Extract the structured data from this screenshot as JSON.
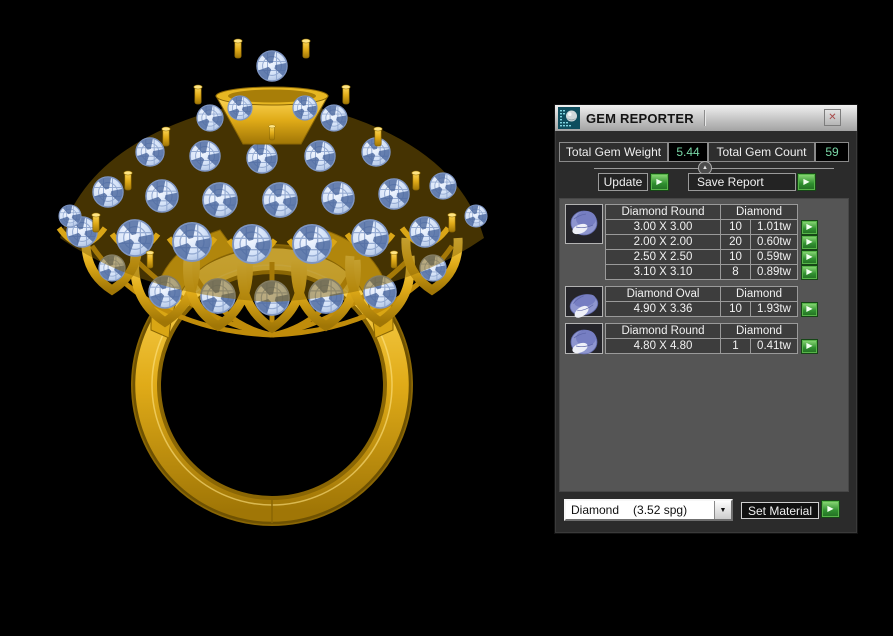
{
  "icons": {
    "app_icon": "gem-reporter-icon",
    "close_glyph": "✕",
    "run_glyph": "▶",
    "dropdown_glyph": "▼",
    "slider_glyph": "▲"
  },
  "window": {
    "title": "GEM REPORTER"
  },
  "stats": {
    "weight_label": "Total Gem Weight",
    "weight_value": "5.44",
    "count_label": "Total Gem Count",
    "count_value": "59"
  },
  "actions": {
    "update_label": "Update",
    "save_report_label": "Save Report",
    "set_material_label": "Set Material"
  },
  "material_combo": {
    "selected_name": "Diamond",
    "selected_density": "(3.52 spg)"
  },
  "gem_list": {
    "groups": [
      {
        "gem_icon": "round-gem-icon",
        "shape": "Diamond Round",
        "material": "Diamond",
        "rows": [
          {
            "size": "3.00 X 3.00",
            "count": "10",
            "weight": "1.01tw"
          },
          {
            "size": "2.00 X 2.00",
            "count": "20",
            "weight": "0.60tw"
          },
          {
            "size": "2.50 X 2.50",
            "count": "10",
            "weight": "0.59tw"
          },
          {
            "size": "3.10 X 3.10",
            "count": "8",
            "weight": "0.89tw"
          }
        ]
      },
      {
        "gem_icon": "oval-gem-icon",
        "shape": "Diamond Oval",
        "material": "Diamond",
        "rows": [
          {
            "size": "4.90 X 3.36",
            "count": "10",
            "weight": "1.93tw"
          }
        ]
      },
      {
        "gem_icon": "round-gem-icon",
        "shape": "Diamond Round",
        "material": "Diamond",
        "rows": [
          {
            "size": "4.80 X 4.80",
            "count": "1",
            "weight": "0.41tw"
          }
        ]
      }
    ]
  },
  "colors": {
    "accent_green": "#2f8f2f",
    "value_green": "#79d6a6",
    "gold": "#d9a614",
    "gem_blue": "#cfe0f6",
    "panel_bg": "#2b2b2b",
    "list_bg": "#555555"
  }
}
